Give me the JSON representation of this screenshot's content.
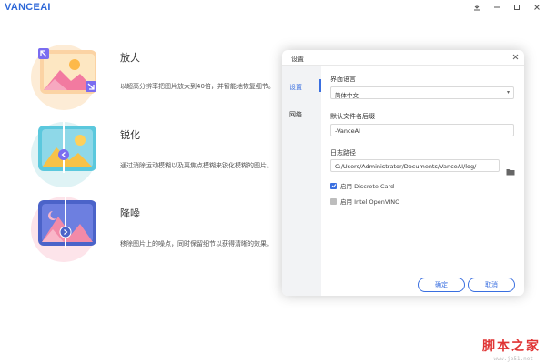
{
  "app": {
    "logo": "VANCEAI",
    "window_buttons": [
      "menu-icon",
      "minimize-icon",
      "maximize-icon",
      "close-icon"
    ]
  },
  "features": [
    {
      "title": "放大",
      "desc": "以超高分辨率把图片放大到40倍，并智能地恢复细节。",
      "icon": "enlarge-icon"
    },
    {
      "title": "锐化",
      "desc": "通过消除运动模糊以及离焦点模糊来锐化模糊的图片。",
      "icon": "sharpen-icon"
    },
    {
      "title": "降噪",
      "desc": "移除图片上的噪点，同时保留细节以获得清晰的效果。",
      "icon": "denoise-icon"
    }
  ],
  "dialog": {
    "title": "设置",
    "nav": [
      {
        "label": "设置",
        "active": true
      },
      {
        "label": "网络",
        "active": false
      }
    ],
    "language": {
      "label": "界面语言",
      "value": "简体中文"
    },
    "suffix": {
      "label": "默认文件名后缀",
      "value": "-VanceAI"
    },
    "log_path": {
      "label": "日志路径",
      "value": "C:/Users/Administrator/Documents/VanceAI/log/"
    },
    "options": [
      {
        "label": "启用 Discrete Card",
        "checked": true
      },
      {
        "label": "启用 Intel OpenVINO",
        "checked": false
      }
    ],
    "buttons": {
      "ok": "确定",
      "cancel": "取消"
    }
  },
  "watermark": {
    "text": "脚本之家",
    "url": "www.jb51.net"
  },
  "colors": {
    "accent": "#3a6fe0",
    "brand": "#2d67d8",
    "watermark": "#e03434"
  }
}
